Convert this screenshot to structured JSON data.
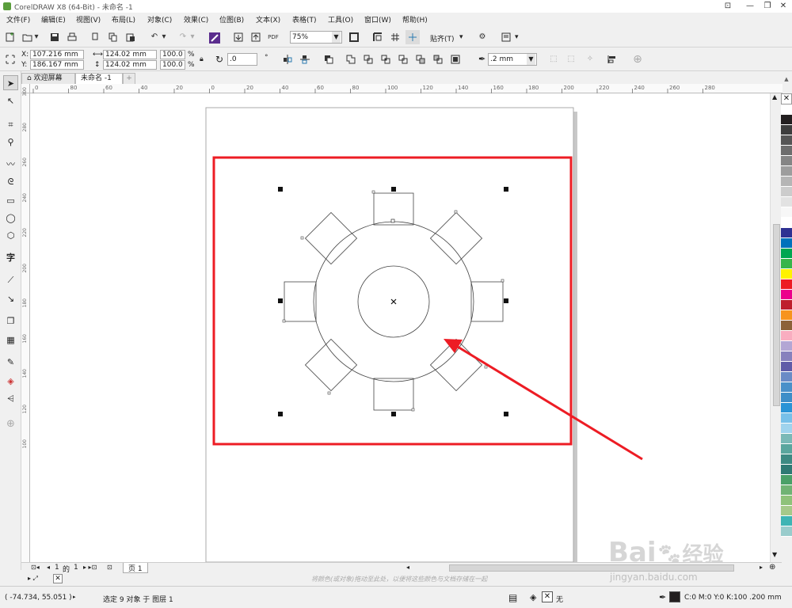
{
  "window": {
    "title": "CorelDRAW X8 (64-Bit) - 未命名 -1"
  },
  "menu": [
    "文件(F)",
    "编辑(E)",
    "视图(V)",
    "布局(L)",
    "对象(C)",
    "效果(C)",
    "位图(B)",
    "文本(X)",
    "表格(T)",
    "工具(O)",
    "窗口(W)",
    "帮助(H)"
  ],
  "toolbar": {
    "zoom": "75%",
    "snap_label": "贴齐(T)",
    "pdf_label": "PDF"
  },
  "props": {
    "x_label": "X:",
    "x_value": "107.216 mm",
    "y_label": "Y:",
    "y_value": "186.167 mm",
    "w_value": "124.02 mm",
    "h_value": "124.02 mm",
    "sx_value": "100.0",
    "sy_value": "100.0",
    "percent": "%",
    "angle_value": ".0",
    "degree": "°",
    "outline_width": ".2 mm"
  },
  "tabs": {
    "welcome": "欢迎屏幕",
    "doc": "未命名 -1",
    "add": "+"
  },
  "ruler": {
    "h_ticks": [
      "0",
      "80",
      "60",
      "40",
      "20",
      "0",
      "20",
      "40",
      "60",
      "80",
      "100",
      "120",
      "140",
      "160",
      "180",
      "200",
      "220",
      "240",
      "260",
      "280"
    ],
    "v_ticks": [
      "300",
      "280",
      "260",
      "240",
      "220",
      "200",
      "180",
      "160",
      "140",
      "120",
      "100"
    ]
  },
  "pages": {
    "current": "1",
    "of": "的",
    "total": "1",
    "page_tab": "页 1"
  },
  "hint": "将颜色(或对象)拖动至此处，以便将这些颜色与文档存储在一起",
  "status": {
    "coords": "( -74.734, 55.051 )",
    "selection": "选定 9 对象 于 图层 1",
    "fill_none": "无",
    "color_info": "C:0 M:0 Y:0 K:100  .200 mm"
  },
  "palette": [
    "#ffffff",
    "#231f20",
    "#3d3d3d",
    "#555555",
    "#6d6d6d",
    "#858585",
    "#9d9d9d",
    "#b5b5b5",
    "#cccccc",
    "#e2e2e2",
    "#f7f7f7",
    "#ffffff",
    "#2e3192",
    "#0072bc",
    "#00a651",
    "#39b54a",
    "#fff200",
    "#ed1c24",
    "#ec008c",
    "#be1e2d",
    "#f7941d",
    "#8c6239",
    "#f9adc0",
    "#b3a6d4",
    "#8781bd",
    "#605ca8",
    "#6b8bc6",
    "#4a90c9",
    "#3e8ec8",
    "#2a94d6",
    "#77c0e9",
    "#9fd3ed",
    "#7ab9b7",
    "#5aa69e",
    "#3d8a83",
    "#2f7a74",
    "#4aa068",
    "#70b374",
    "#8fc27a",
    "#a6c98a",
    "#3eb4b4",
    "#99cccc"
  ],
  "annotation": {
    "color": "#ed1c24"
  },
  "watermark": {
    "brand": "Bai",
    "brand2": "经验",
    "url": "jingyan.baidu.com"
  }
}
